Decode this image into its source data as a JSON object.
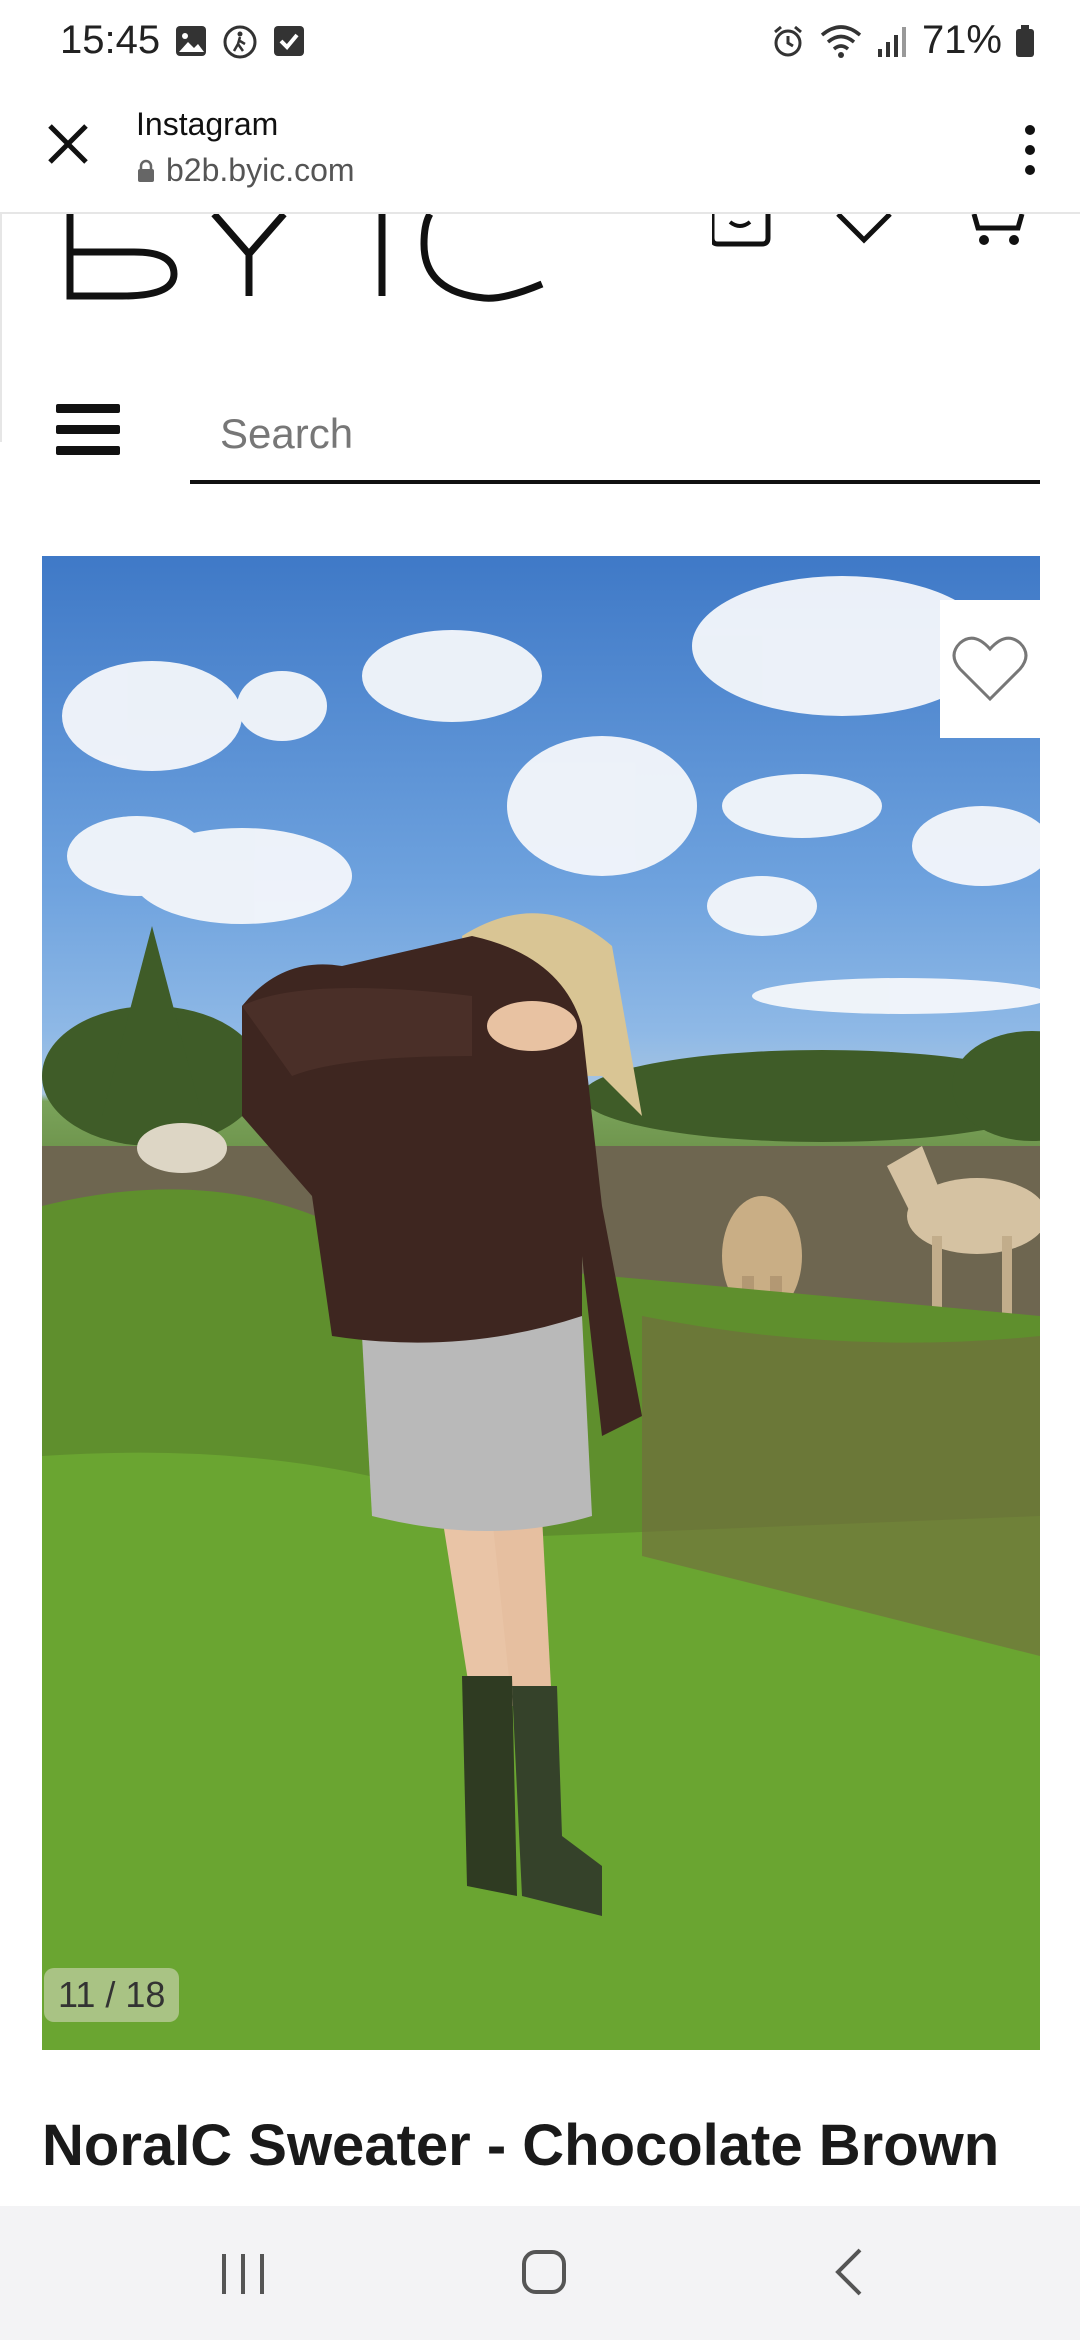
{
  "status_bar": {
    "time": "15:45",
    "battery": "71%",
    "left_icons": [
      "gallery-icon",
      "accessibility-icon",
      "checkbox-icon"
    ],
    "right_icons": [
      "alarm-icon",
      "wifi-icon",
      "signal-icon",
      "battery-icon"
    ]
  },
  "browser": {
    "title": "Instagram",
    "url": "b2b.byic.com"
  },
  "site": {
    "logo_text": "BYIC",
    "search_placeholder": "Search"
  },
  "product": {
    "image_counter": "11 / 18",
    "title": "NoraIC Sweater - Chocolate Brown"
  },
  "colors": {
    "accent": "#111111",
    "nav_background": "#f3f3f5",
    "sweater": "#3e2620",
    "skirt": "#b9b9b9"
  }
}
